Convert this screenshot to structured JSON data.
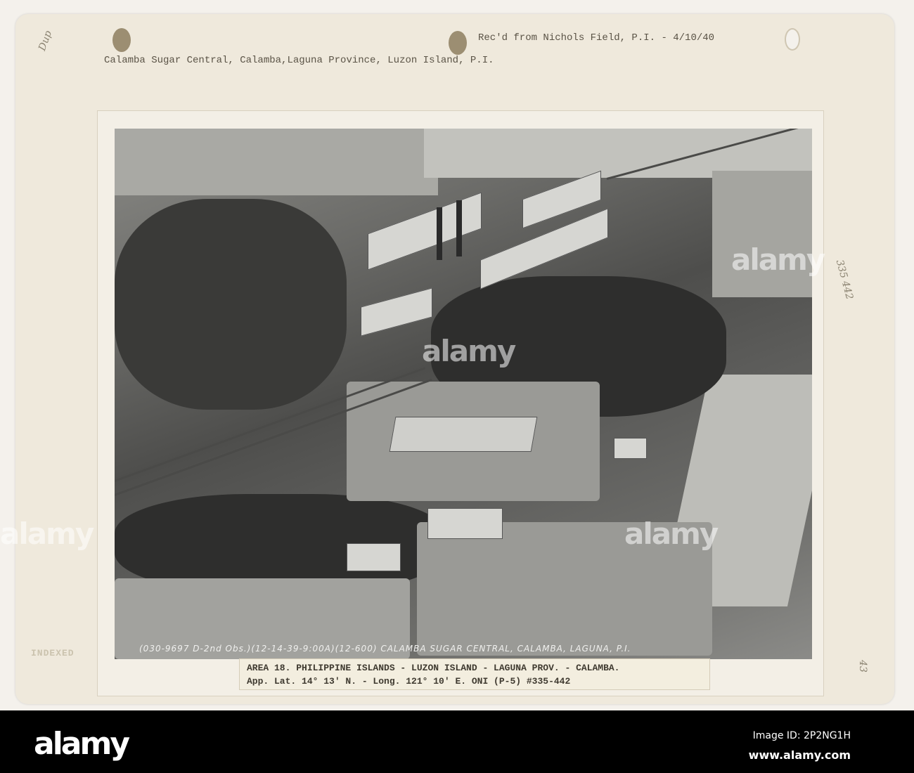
{
  "card": {
    "received_note": "Rec'd from Nichols Field, P.I. - 4/10/40",
    "title": "Calamba Sugar Central, Calamba,Laguna Province, Luzon Island, P.I.",
    "handwritten_top_left": "Dup",
    "handwritten_right": "335 442",
    "handwritten_bottom_right": "43",
    "stamp": "INDEXED"
  },
  "photo": {
    "caption": "(030-9697 D-2nd Obs.)(12-14-39-9:00A)(12-600) CALAMBA SUGAR CENTRAL, CALAMBA, LAGUNA, P.I."
  },
  "label": {
    "line1": "AREA 18.  PHILIPPINE ISLANDS - LUZON ISLAND - LAGUNA PROV. - CALAMBA.",
    "line2": "App. Lat. 14° 13' N. - Long. 121° 10' E.  ONI (P-5)  #335-442"
  },
  "watermark": {
    "text": "alamy",
    "logo": "alamy",
    "image_id": "Image ID: 2P2NG1H",
    "website": "www.alamy.com"
  }
}
